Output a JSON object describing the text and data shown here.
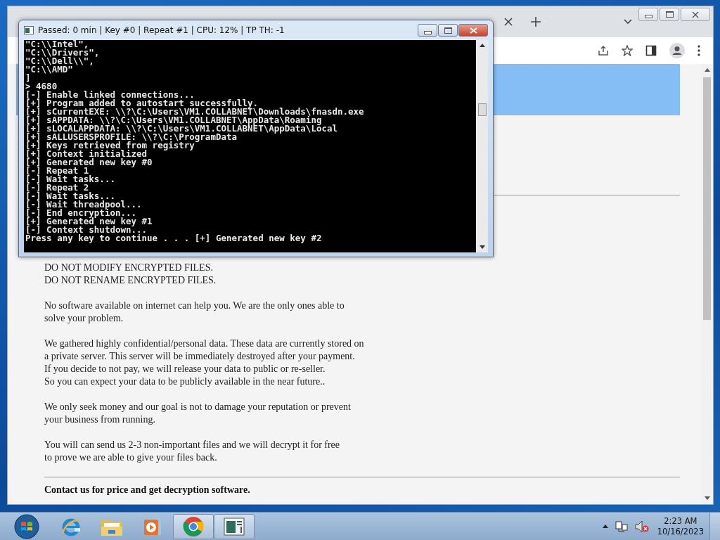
{
  "console": {
    "title": "Passed: 0 min | Key #0 | Repeat #1 | CPU: 12% | TP TH: -1",
    "lines": [
      "\"C:\\\\Intel\",",
      "\"C:\\\\Drivers\",",
      "\"C:\\\\Dell\\\\\",",
      "\"C:\\\\AMD\"",
      "]",
      "> 4680",
      "[-] Enable linked connections...",
      "[+] Program added to autostart successfully.",
      "[+] sCurrentEXE: \\\\?\\C:\\Users\\VM1.COLLABNET\\Downloads\\fnasdn.exe",
      "[+] sAPPDATA: \\\\?\\C:\\Users\\VM1.COLLABNET\\AppData\\Roaming",
      "[+] sLOCALAPPDATA: \\\\?\\C:\\Users\\VM1.COLLABNET\\AppData\\Local",
      "[+] sALLUSERSPROFILE: \\\\?\\C:\\ProgramData",
      "[+] Keys retrieved from registry",
      "[+] Context initialized",
      "[+] Generated new key #0",
      "[-] Repeat 1",
      "[-] Wait tasks...",
      "[-] Repeat 2",
      "[-] Wait tasks...",
      "[-] Wait threadpool...",
      "[-] End encryption...",
      "[+] Generated new key #1",
      "[-] Context shutdown...",
      "Press any key to continue . . . [+] Generated new key #2"
    ]
  },
  "page": {
    "paragraphs": [
      "DO NOT MODIFY ENCRYPTED FILES.\nDO NOT RENAME ENCRYPTED FILES.",
      "No software available on internet can help you. We are the only ones able to\nsolve your problem.",
      "We gathered highly confidential/personal data. These data are currently stored on\na private server. This server will be immediately destroyed after your payment.\nIf you decide to not pay, we will release your data to public or re-seller.\nSo you can expect your data to be publicly available in the near future..",
      "We only seek money and our goal is not to damage your reputation or prevent\nyour business from running.",
      "You will can send us 2-3 non-important files and we will decrypt it for free\nto prove we are able to give your files back."
    ],
    "contact": "Contact us for price and get decryption software."
  },
  "taskbar": {
    "apps": [
      {
        "kind": "browser-e",
        "open": false
      },
      {
        "kind": "folder",
        "open": false
      },
      {
        "kind": "media",
        "open": false
      },
      {
        "kind": "chrome",
        "open": true
      },
      {
        "kind": "console",
        "open": true
      }
    ],
    "clock": {
      "time": "2:23 AM",
      "date": "10/16/2023"
    }
  }
}
